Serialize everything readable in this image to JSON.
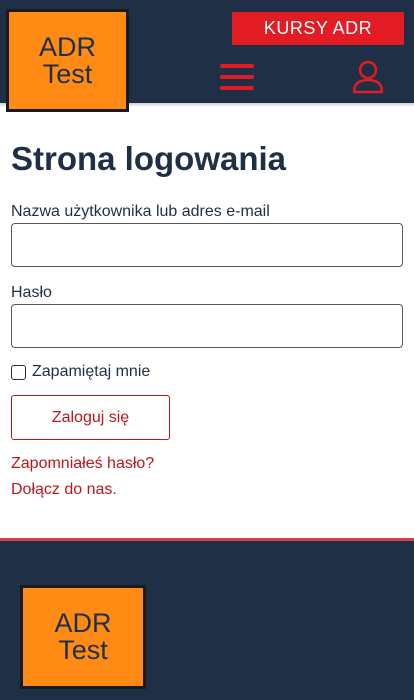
{
  "header": {
    "logo": {
      "line1": "ADR",
      "line2": "Test"
    },
    "cta_label": "KURSY ADR",
    "menu_icon": "hamburger-menu-icon",
    "user_icon": "user-account-icon"
  },
  "main": {
    "title": "Strona logowania",
    "username_label": "Nazwa użytkownika lub adres e-mail",
    "username_value": "",
    "password_label": "Hasło",
    "password_value": "",
    "remember_label": "Zapamiętaj mnie",
    "remember_checked": false,
    "login_button": "Zaloguj się",
    "forgot_link": "Zapomniałeś hasło?",
    "join_link": "Dołącz do nas."
  },
  "footer": {
    "logo": {
      "line1": "ADR",
      "line2": "Test"
    }
  },
  "colors": {
    "navy": "#1f2f46",
    "orange": "#ff8a14",
    "red": "#e31b23",
    "link_red": "#c0141c"
  }
}
